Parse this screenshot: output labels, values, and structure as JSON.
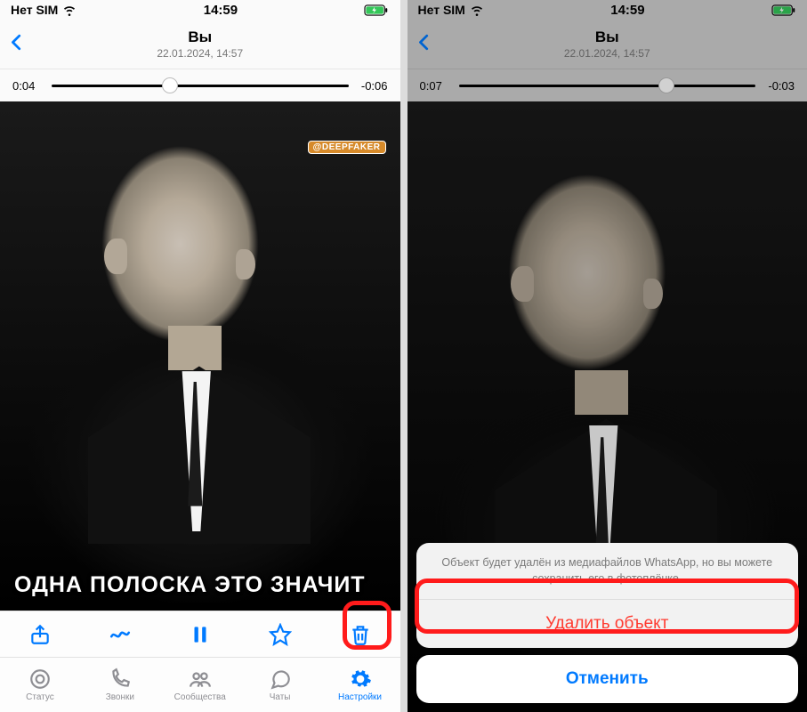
{
  "status": {
    "carrier": "Нет SIM",
    "time": "14:59"
  },
  "header": {
    "back_icon": "chevron-left",
    "title": "Вы",
    "subtitle": "22.01.2024, 14:57"
  },
  "left": {
    "scrub": {
      "elapsed": "0:04",
      "remaining": "-0:06",
      "progress_pct": 40
    },
    "caption": "ОДНА ПОЛОСКА ЭТО ЗНАЧИТ",
    "watermark": "@DEEPFAKER"
  },
  "right": {
    "scrub": {
      "elapsed": "0:07",
      "remaining": "-0:03",
      "progress_pct": 70
    }
  },
  "toolbar": {
    "share": "share",
    "draw": "scribble",
    "pause": "pause",
    "star": "star",
    "trash": "trash"
  },
  "tabs": {
    "items": [
      {
        "label": "Статус",
        "icon": "status"
      },
      {
        "label": "Звонки",
        "icon": "phone"
      },
      {
        "label": "Сообщества",
        "icon": "people"
      },
      {
        "label": "Чаты",
        "icon": "chat"
      },
      {
        "label": "Настройки",
        "icon": "gear"
      }
    ],
    "active_index": 4
  },
  "sheet": {
    "message": "Объект будет удалён из медиафайлов WhatsApp, но вы можете сохранить его в фотоплёнке.",
    "delete": "Удалить объект",
    "cancel": "Отменить"
  }
}
